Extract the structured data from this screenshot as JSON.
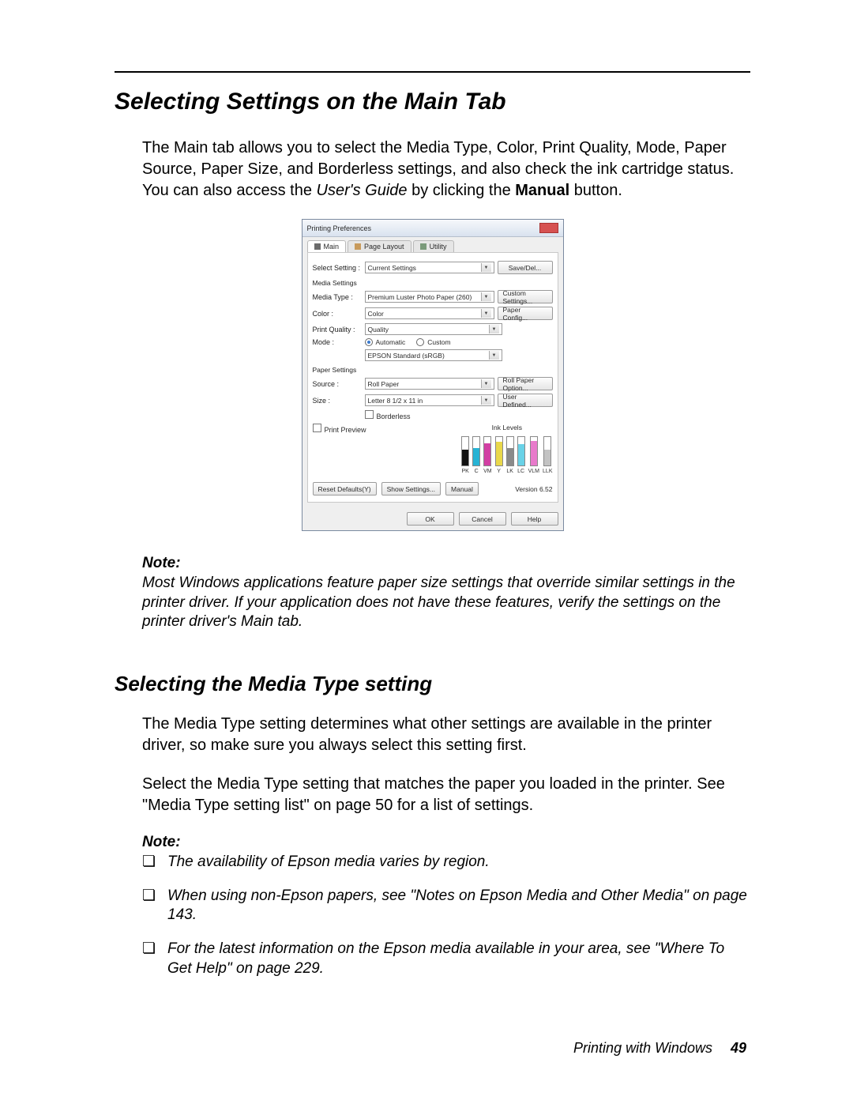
{
  "headings": {
    "h1": "Selecting Settings on the Main Tab",
    "h2": "Selecting the Media Type setting"
  },
  "para1_a": "The Main tab allows you to select the Media Type, Color, Print Quality, Mode, Paper Source, Paper Size, and Borderless settings, and also check the ink cartridge status. You can also access the ",
  "para1_italic": "User's Guide",
  "para1_b": " by clicking the ",
  "para1_bold": "Manual",
  "para1_c": " button.",
  "note1": {
    "label": "Note:",
    "body": "Most Windows applications feature paper size settings that override similar settings in the printer driver. If your application does not have these features, verify the settings on the printer driver's Main tab."
  },
  "para2": "The Media Type setting determines what other settings are available in the printer driver, so make sure you always select this setting first.",
  "para3": "Select the Media Type setting that matches the paper you loaded in the printer. See \"Media Type setting list\" on page 50 for a list of settings.",
  "note2": {
    "label": "Note:",
    "items": [
      "The availability of Epson media varies by region.",
      "When using non-Epson papers, see \"Notes on Epson Media and Other Media\" on page 143.",
      "For the latest information on the Epson media available in your area, see \"Where To Get Help\" on page 229."
    ]
  },
  "footer": {
    "chapter": "Printing with Windows",
    "page": "49"
  },
  "dialog": {
    "title": "Printing Preferences",
    "tabs": {
      "main": "Main",
      "page_layout": "Page Layout",
      "utility": "Utility"
    },
    "select_setting_label": "Select Setting :",
    "select_setting_value": "Current Settings",
    "save_del": "Save/Del...",
    "media_settings_label": "Media Settings",
    "media_type_label": "Media Type :",
    "media_type_value": "Premium Luster Photo Paper (260)",
    "custom_settings": "Custom Settings...",
    "color_label": "Color :",
    "color_value": "Color",
    "paper_config": "Paper Config...",
    "print_quality_label": "Print Quality :",
    "print_quality_value": "Quality",
    "mode_label": "Mode :",
    "mode_auto": "Automatic",
    "mode_custom": "Custom",
    "mode_profile": "EPSON Standard (sRGB)",
    "paper_settings_label": "Paper Settings",
    "source_label": "Source :",
    "source_value": "Roll Paper",
    "roll_option": "Roll Paper Option...",
    "size_label": "Size :",
    "size_value": "Letter 8 1/2 x 11 in",
    "user_defined": "User Defined...",
    "borderless": "Borderless",
    "print_preview": "Print Preview",
    "ink_levels_label": "Ink Levels",
    "inks": [
      {
        "name": "PK",
        "level": 0.55,
        "color": "#111111"
      },
      {
        "name": "C",
        "level": 0.6,
        "color": "#27b3d4"
      },
      {
        "name": "VM",
        "level": 0.78,
        "color": "#d23fa3"
      },
      {
        "name": "Y",
        "level": 0.82,
        "color": "#e9d84a"
      },
      {
        "name": "LK",
        "level": 0.62,
        "color": "#8a8a8a"
      },
      {
        "name": "LC",
        "level": 0.74,
        "color": "#69d2e7"
      },
      {
        "name": "VLM",
        "level": 0.85,
        "color": "#e87acb"
      },
      {
        "name": "LLK",
        "level": 0.55,
        "color": "#c3c3c3"
      }
    ],
    "reset_defaults": "Reset Defaults(Y)",
    "show_settings": "Show Settings...",
    "manual": "Manual",
    "version": "Version 6.52",
    "ok": "OK",
    "cancel": "Cancel",
    "help": "Help"
  }
}
